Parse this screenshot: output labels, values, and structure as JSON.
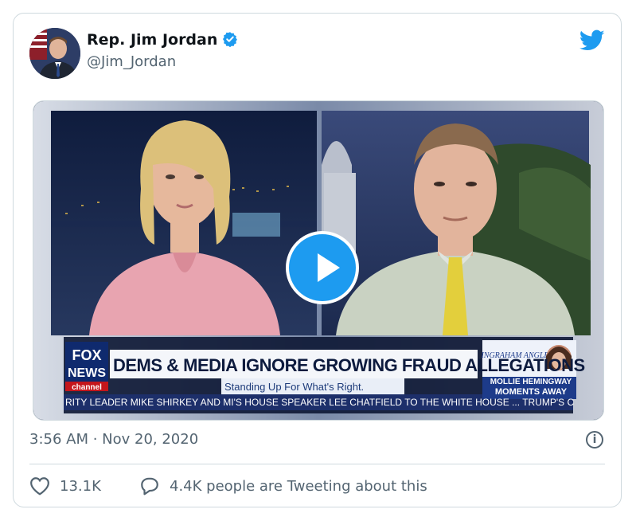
{
  "author": {
    "name": "Rep. Jim Jordan",
    "handle": "@Jim_Jordan",
    "verified": true
  },
  "video": {
    "headline": "DEMS & MEDIA IGNORE GROWING FRAUD ALLEGATIONS",
    "subheadline": "Standing Up For What's Right.",
    "crawl": "RITY LEADER MIKE SHIRKEY AND MI'S HOUSE SPEAKER LEE CHATFIELD TO THE WHITE HOUSE ... TRUMP'S C",
    "network_line1": "FOX",
    "network_line2": "NEWS",
    "network_line3": "channel",
    "show_name": "INGRAHAM ANGLE",
    "promo_line1": "MOLLIE HEMINGWAY",
    "promo_line2": "MOMENTS AWAY"
  },
  "timestamp": "3:56 AM · Nov 20, 2020",
  "likes_count": "13.1K",
  "replies_text": "4.4K people are Tweeting about this",
  "colors": {
    "accent": "#1d9bf0",
    "secondary_text": "#536471",
    "border": "#cfd9de"
  }
}
